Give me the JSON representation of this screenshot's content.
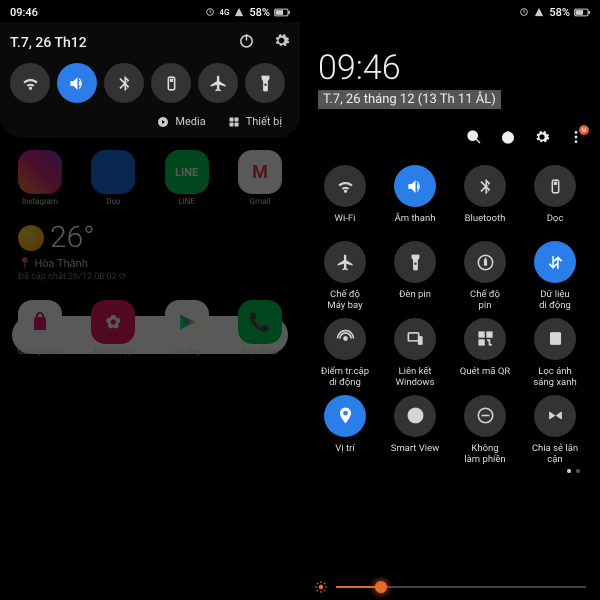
{
  "status": {
    "time": "09:46",
    "battery": "58%",
    "network": "4G"
  },
  "left": {
    "date": "T.7, 26 Th12",
    "mediaLabel": "Media",
    "deviceLabel": "Thiết bị",
    "apps": {
      "instagram": "Instagram",
      "duo": "Duo",
      "line": "LINE",
      "gmail": "Gmail",
      "galaxy": "Galaxy Store",
      "settings": "Bộ sưu tập",
      "play": "CH Play",
      "phone": "Điện thoại"
    },
    "weather": {
      "temp": "26°",
      "loc": "Hòa Thành",
      "updated": "Đã cập nhật 26/12 08:02 ⟳"
    }
  },
  "right": {
    "clock": "09:46",
    "date": "T.7, 26 tháng 12 (13 Th 11 ÂL)",
    "badge": "M",
    "tiles": {
      "wifi": "Wi-Fi",
      "sound": "Âm thanh",
      "bt": "Bluetooth",
      "rotate": "Dọc",
      "airplane": "Chế độ\nMáy bay",
      "flash": "Đèn pin",
      "power": "Chế độ\npin",
      "data": "Dữ liệu\ndi động",
      "hotspot": "Điểm tr.cập\ndi động",
      "link": "Liên kết\nWindows",
      "qr": "Quét mã QR",
      "blue": "Lọc ánh\nsáng xanh",
      "location": "Vị trí",
      "smart": "Smart View",
      "dnd": "Không\nlàm phiền",
      "share": "Chia sẻ lân\ncận"
    }
  }
}
